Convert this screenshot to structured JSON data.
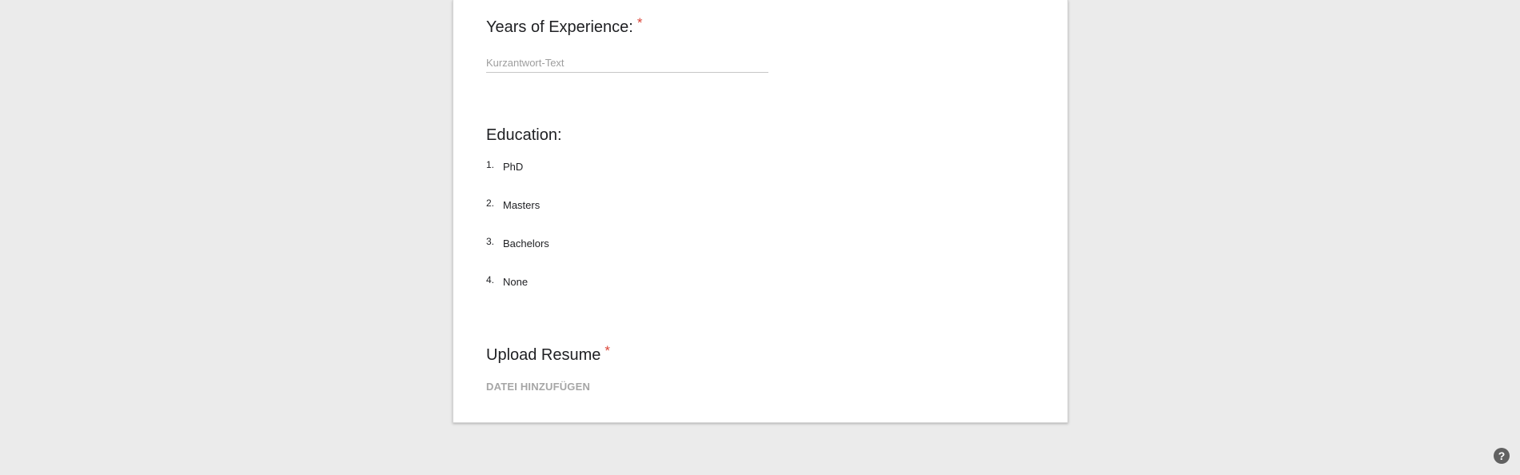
{
  "form": {
    "experience": {
      "title": "Years of Experience:",
      "required_mark": "*",
      "placeholder": "Kurzantwort-Text"
    },
    "education": {
      "title": "Education:",
      "items": [
        {
          "num": "1.",
          "label": "PhD"
        },
        {
          "num": "2.",
          "label": "Masters"
        },
        {
          "num": "3.",
          "label": "Bachelors"
        },
        {
          "num": "4.",
          "label": "None"
        }
      ]
    },
    "resume": {
      "title": "Upload Resume",
      "required_mark": "*",
      "upload_label": "DATEI HINZUFÜGEN"
    }
  },
  "help": {
    "icon": "help-icon",
    "glyph": "?"
  },
  "colors": {
    "background": "#ebebeb",
    "card": "#ffffff",
    "required": "#db4437",
    "muted": "#a6a6a6",
    "help_button": "#616161"
  }
}
